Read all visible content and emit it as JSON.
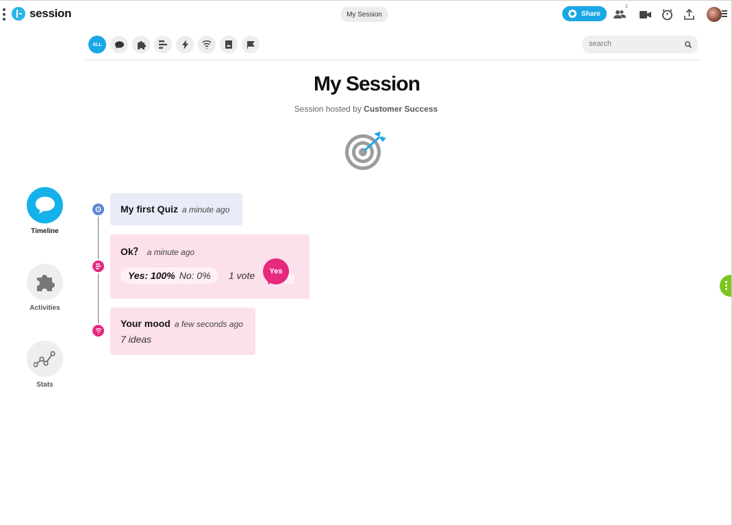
{
  "app": {
    "name": "session"
  },
  "header": {
    "session_pill": "My Session",
    "share_label": "Share",
    "participants_count": "1"
  },
  "search": {
    "placeholder": "search"
  },
  "filters": {
    "all_label": "ALL"
  },
  "page": {
    "title": "My Session",
    "subtitle_prefix": "Session hosted by",
    "host": "Customer Success"
  },
  "sidebar": {
    "items": [
      {
        "label": "Timeline"
      },
      {
        "label": "Activities"
      },
      {
        "label": "Stats"
      }
    ]
  },
  "timeline": {
    "items": [
      {
        "title": "My first Quiz",
        "time": "a minute ago"
      },
      {
        "title": "Ok？",
        "time": "a minute ago",
        "yes_result": "Yes: 100%",
        "no_result": "No: 0%",
        "votes": "1 vote",
        "bubble": "Yes"
      },
      {
        "title": "Your mood",
        "time": "a few seconds ago",
        "summary": "7 ideas"
      }
    ]
  },
  "colors": {
    "accent": "#1aa7e6",
    "quiz_card": "#e9ecf8",
    "poll_card": "#fce0ec",
    "poll_accent": "#e52a7e",
    "quiz_accent": "#5b84d6",
    "handle": "#7cc520"
  },
  "icons": [
    "kebab-menu-icon",
    "logo-icon",
    "globe-icon",
    "participants-icon",
    "video-icon",
    "timer-icon",
    "upload-icon",
    "chat-icon",
    "puzzle-icon",
    "poll-icon",
    "lightning-icon",
    "wordcloud-icon",
    "image-icon",
    "flag-icon",
    "search-icon",
    "target-icon",
    "stats-icon"
  ]
}
